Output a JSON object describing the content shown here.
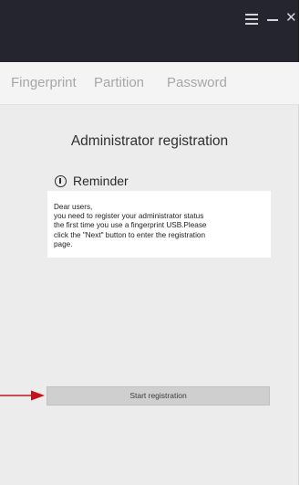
{
  "window": {
    "controls": {
      "menu_icon": "hamburger-icon",
      "minimize_icon": "minimize-icon",
      "close_icon": "close-icon",
      "close_glyph": "✕"
    },
    "titlebar_color": "#24252f"
  },
  "tabs": [
    {
      "label": "Fingerprint"
    },
    {
      "label": "Partition"
    },
    {
      "label": "Password"
    }
  ],
  "main": {
    "title": "Administrator registration",
    "reminder": {
      "icon": "info-icon",
      "label": "Reminder"
    },
    "notice_lines": [
      "Dear users,",
      "you need to register your administrator status",
      "the first time you use a fingerprint USB.Please",
      "click the \"Next\" button to enter the registration",
      "page."
    ],
    "start_button_label": "Start registration"
  },
  "annotation": {
    "arrow_color": "#c0141c",
    "arrow_icon": "arrow-right-icon"
  }
}
